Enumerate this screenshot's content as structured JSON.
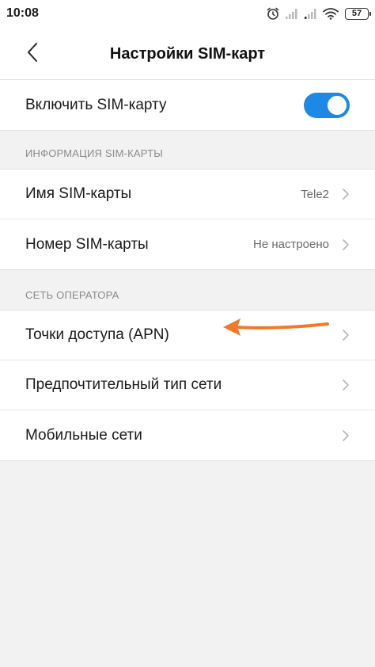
{
  "status_bar": {
    "time": "10:08",
    "battery": "57"
  },
  "header": {
    "back_icon": "chevron-left-icon",
    "title": "Настройки SIM-карт"
  },
  "enable_sim": {
    "label": "Включить SIM-карту",
    "enabled": true,
    "toggle_color": "#1e88e5"
  },
  "sim_info": {
    "header": "ИНФОРМАЦИЯ SIM-КАРТЫ",
    "items": [
      {
        "label": "Имя SIM-карты",
        "value": "Tele2"
      },
      {
        "label": "Номер SIM-карты",
        "value": "Не настроено"
      }
    ]
  },
  "operator_network": {
    "header": "СЕТЬ ОПЕРАТОРА",
    "items": [
      {
        "label": "Точки доступа (APN)"
      },
      {
        "label": "Предпочтительный тип сети"
      },
      {
        "label": "Мобильные сети"
      }
    ]
  },
  "annotation": {
    "arrow_color": "#f07a2a"
  }
}
